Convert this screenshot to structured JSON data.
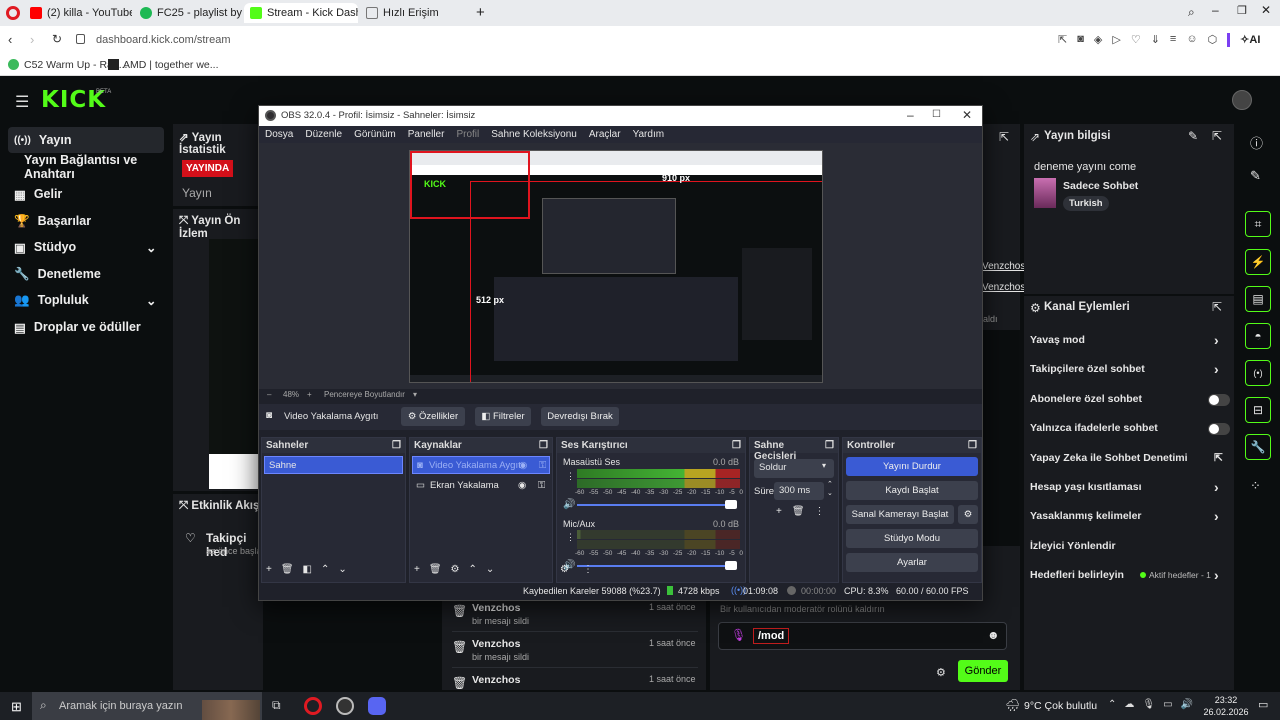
{
  "browser": {
    "tabs": [
      {
        "label": "(2) killa - YouTube",
        "color": "#ff0000"
      },
      {
        "label": "FC25 - playlist by Mertay",
        "color": "#1db954"
      },
      {
        "label": "Stream - Kick Dashboard",
        "color": "#53fc18"
      },
      {
        "label": "Hızlı Erişim",
        "color": "#888888"
      }
    ],
    "url": "dashboard.kick.com/stream",
    "bookmarks": [
      {
        "label": "C52 Warm Up - Ran..."
      },
      {
        "label": "AMD | together we..."
      }
    ]
  },
  "kick": {
    "logo": "KICK",
    "logo_badge": "BETA",
    "sidebar": [
      {
        "label": "Yayın",
        "icon": "broadcast-icon"
      },
      {
        "label": "Yayın Bağlantısı ve Anahtarı",
        "icon": ""
      },
      {
        "label": "Gelir",
        "icon": "revenue-icon"
      },
      {
        "label": "Başarılar",
        "icon": "trophy-icon"
      },
      {
        "label": "Stüdyo",
        "icon": "studio-icon"
      },
      {
        "label": "Denetleme",
        "icon": "wrench-icon"
      },
      {
        "label": "Topluluk",
        "icon": "people-icon"
      },
      {
        "label": "Droplar ve ödüller",
        "icon": "gift-icon"
      }
    ],
    "stats_title": "Yayın İstatistik",
    "live_badge": "YAYINDA",
    "stats_sub": "Yayın",
    "preview_title": "Yayın Ön İzlem",
    "activity_title": "Etkinlik Akışı",
    "activity_item": {
      "title": "Takipçi hed",
      "sub": "az önce başla"
    },
    "chat_names": [
      "Venzchos",
      "Venzchos"
    ],
    "chat_muted": "aldı",
    "mod_log": [
      {
        "name": "Venzchos",
        "action": "bir mesajı sildi",
        "time": "1 saat önce"
      },
      {
        "name": "Venzchos",
        "action": "bir mesajı sildi",
        "time": "1 saat önce"
      },
      {
        "name": "Venzchos",
        "action": "",
        "time": "1 saat önce"
      }
    ],
    "chat_hint": "Bir kullanıcıdan moderatör rolünü kaldırın",
    "chat_input": "/mod",
    "send": "Gönder",
    "stream_info": {
      "title": "Yayın bilgisi",
      "stream_title": "deneme yayını come",
      "category": "Sadece Sohbet",
      "language": "Turkish"
    },
    "channel_actions": {
      "title": "Kanal Eylemleri",
      "items": [
        {
          "label": "Yavaş mod",
          "kind": "arrow"
        },
        {
          "label": "Takipçilere özel sohbet",
          "kind": "arrow"
        },
        {
          "label": "Abonelere özel sohbet",
          "kind": "toggle"
        },
        {
          "label": "Yalnızca ifadelerle sohbet",
          "kind": "toggle"
        },
        {
          "label": "Yapay Zeka ile Sohbet Denetimi",
          "kind": "external"
        },
        {
          "label": "Hesap yaşı kısıtlaması",
          "kind": "arrow"
        },
        {
          "label": "Yasaklanmış kelimeler",
          "kind": "arrow"
        },
        {
          "label": "İzleyici Yönlendir",
          "kind": "none"
        },
        {
          "label": "Hedefleri belirleyin",
          "kind": "goal"
        }
      ],
      "goal_status": "Aktif hedefler - 1"
    }
  },
  "obs": {
    "title": "OBS 32.0.4 - Profil: İsimsiz - Sahneler: İsimsiz",
    "menu": [
      "Dosya",
      "Düzenle",
      "Görünüm",
      "Paneller",
      "Profil",
      "Sahne Koleksiyonu",
      "Araçlar",
      "Yardım"
    ],
    "preview": {
      "measure_top": "910 px",
      "measure_left": "512 px"
    },
    "zoom": "48%",
    "fit_label": "Pencereye Boyutlandır",
    "source_bar": {
      "source": "Video Yakalama Aygıtı",
      "props": "Özellikler",
      "filters": "Filtreler",
      "deactivate": "Devredışı Bırak"
    },
    "docks": {
      "scenes": {
        "title": "Sahneler",
        "items": [
          "Sahne"
        ]
      },
      "sources": {
        "title": "Kaynaklar",
        "items": [
          "Video Yakalama Aygıtı",
          "Ekran Yakalama"
        ]
      },
      "mixer": {
        "title": "Ses Karıştırıcı",
        "channels": [
          {
            "name": "Masaüstü Ses",
            "db": "0.0 dB"
          },
          {
            "name": "Mic/Aux",
            "db": "0.0 dB"
          }
        ],
        "ticks": [
          "-60",
          "-55",
          "-50",
          "-45",
          "-40",
          "-35",
          "-30",
          "-25",
          "-20",
          "-15",
          "-10",
          "-5",
          "0"
        ]
      },
      "transitions": {
        "title": "Sahne Geçişleri",
        "type": "Soldur",
        "duration_label": "Süre",
        "duration": "300 ms"
      },
      "controls": {
        "title": "Kontroller",
        "buttons": [
          "Yayını Durdur",
          "Kaydı Başlat",
          "Sanal Kamerayı Başlat",
          "Stüdyo Modu",
          "Ayarlar"
        ]
      }
    },
    "status": {
      "dropped": "Kaybedilen Kareler 59088 (%23.7)",
      "bitrate": "4728 kbps",
      "live_time": "01:09:08",
      "rec_time": "00:00:00",
      "cpu": "CPU: 8.3%",
      "fps": "60.00 / 60.00 FPS"
    }
  },
  "taskbar": {
    "search": "Aramak için buraya yazın",
    "weather": "9°C  Çok bulutlu",
    "time": "23:32",
    "date": "26.02.2026"
  }
}
